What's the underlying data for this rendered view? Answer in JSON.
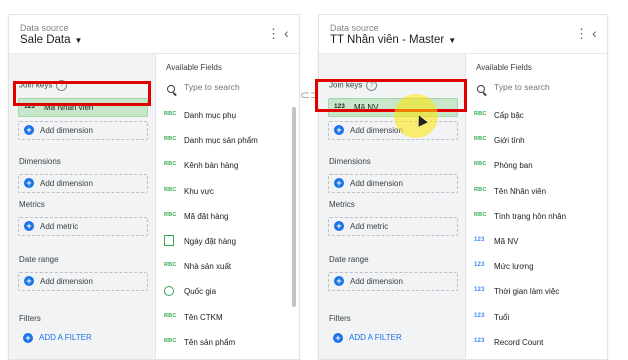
{
  "left_panel": {
    "ds_label": "Data source",
    "ds_name": "Sale Data",
    "join_keys_label": "Join keys",
    "join_key": {
      "type": "123",
      "name": "Mã Nhân viên"
    },
    "add_dimension": "Add dimension",
    "dimensions_label": "Dimensions",
    "dimensions_add": "Add dimension",
    "metrics_label": "Metrics",
    "metrics_add": "Add metric",
    "date_range_label": "Date range",
    "date_range_add": "Add dimension",
    "filters_label": "Filters",
    "add_filter": "ADD A FILTER",
    "fields_title": "Available Fields",
    "search_placeholder": "Type to search",
    "fields": [
      {
        "icon": "RBC",
        "name": "Danh mục phụ"
      },
      {
        "icon": "RBC",
        "name": "Danh mục sản phẩm"
      },
      {
        "icon": "RBC",
        "name": "Kênh bán hàng"
      },
      {
        "icon": "RBC",
        "name": "Khu vực"
      },
      {
        "icon": "RBC",
        "name": "Mã đặt hàng"
      },
      {
        "icon": "date",
        "name": "Ngày đặt hàng"
      },
      {
        "icon": "RBC",
        "name": "Nhà sản xuất"
      },
      {
        "icon": "geo",
        "name": "Quốc gia"
      },
      {
        "icon": "RBC",
        "name": "Tên CTKM"
      },
      {
        "icon": "RBC",
        "name": "Tên sản phẩm"
      }
    ]
  },
  "right_panel": {
    "ds_label": "Data source",
    "ds_name": "TT Nhân viên - Master",
    "join_keys_label": "Join keys",
    "join_key": {
      "type": "123",
      "name": "Mã NV"
    },
    "add_dimension": "Add dimension",
    "dimensions_label": "Dimensions",
    "dimensions_add": "Add dimension",
    "metrics_label": "Metrics",
    "metrics_add": "Add metric",
    "date_range_label": "Date range",
    "date_range_add": "Add dimension",
    "filters_label": "Filters",
    "add_filter": "ADD A FILTER",
    "fields_title": "Available Fields",
    "search_placeholder": "Type to search",
    "fields": [
      {
        "icon": "RBC",
        "name": "Cấp bậc"
      },
      {
        "icon": "RBC",
        "name": "Giới tính"
      },
      {
        "icon": "RBC",
        "name": "Phòng ban"
      },
      {
        "icon": "RBC",
        "name": "Tên Nhân viên"
      },
      {
        "icon": "RBC",
        "name": "Tình trạng hôn nhân"
      },
      {
        "icon": "123",
        "name": "Mã NV"
      },
      {
        "icon": "123",
        "name": "Mức lương"
      },
      {
        "icon": "123",
        "name": "Thời gian làm việc"
      },
      {
        "icon": "123",
        "name": "Tuổi"
      },
      {
        "icon": "123",
        "name": "Record Count"
      }
    ]
  },
  "colors": {
    "highlight": "#e00000",
    "key_chip": "#c8e6c9",
    "accent": "#1a73e8"
  },
  "icons": {
    "kebab": "more-vert-icon",
    "collapse": "chevron-left-icon",
    "link": "link-icon"
  }
}
